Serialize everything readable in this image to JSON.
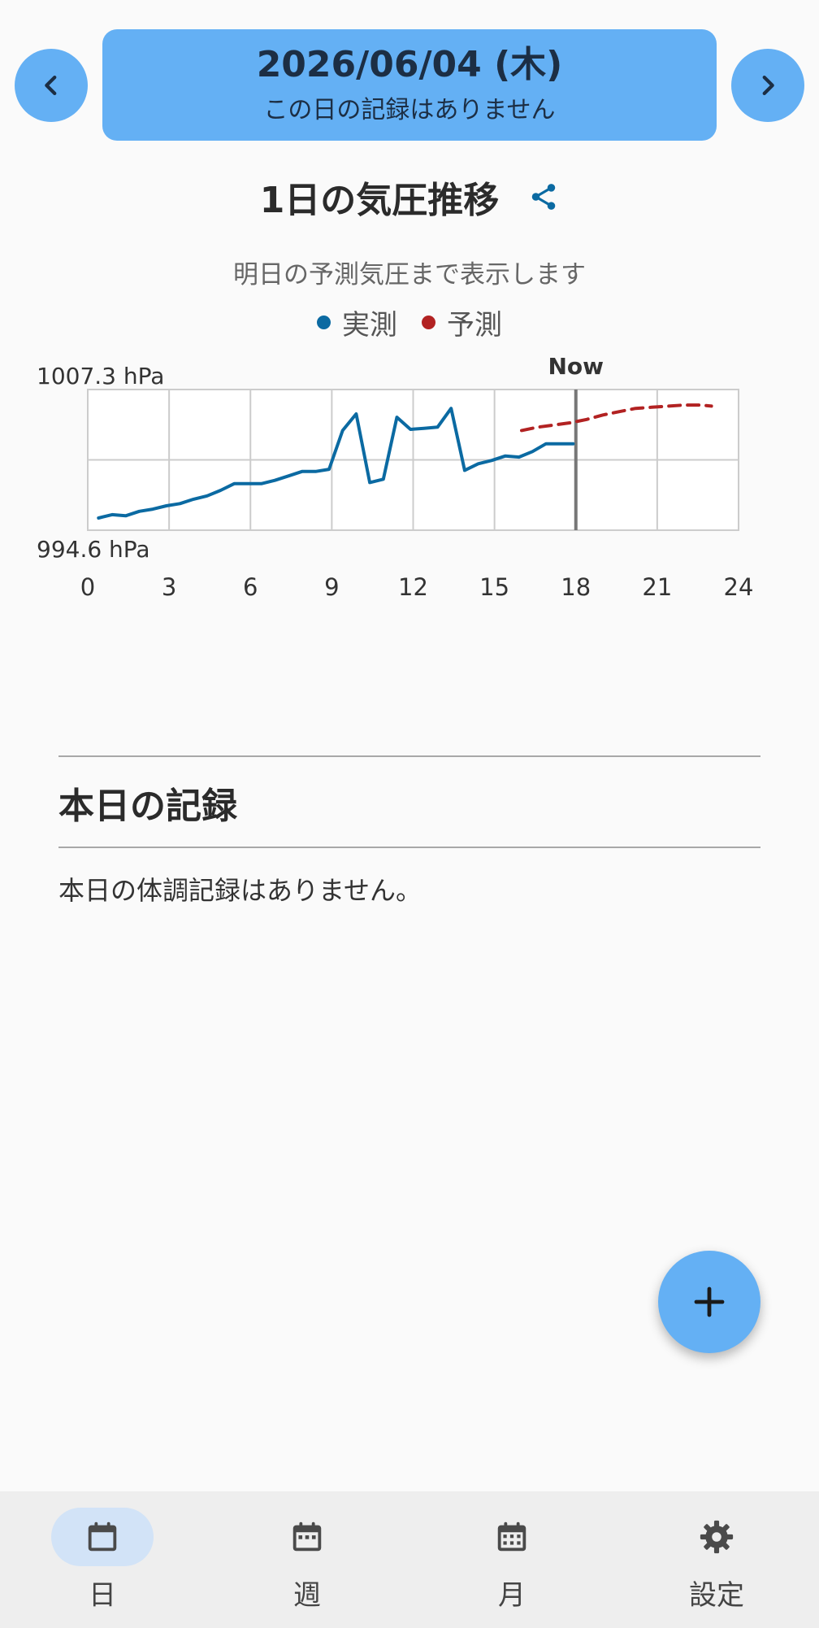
{
  "header": {
    "date": "2026/06/04 (木)",
    "subtitle": "この日の記録はありません",
    "prev_icon": "chevron-left-icon",
    "next_icon": "chevron-right-icon",
    "accent": "#64b0f4"
  },
  "chart_section": {
    "title": "1日の気圧推移",
    "share_icon": "share-icon",
    "subtitle": "明日の予測気圧まで表示します"
  },
  "chart_data": {
    "type": "line",
    "title": "",
    "xlabel": "",
    "ylabel": "",
    "xlim": [
      0,
      24
    ],
    "ylim": [
      994.6,
      1007.3
    ],
    "ylim_labels": [
      "1007.3 hPa",
      "994.6 hPa"
    ],
    "x_ticks": [
      "0",
      "3",
      "6",
      "9",
      "12",
      "15",
      "18",
      "21",
      "24"
    ],
    "now_label": "Now",
    "now_x": 18,
    "grid": true,
    "legend_position": "top",
    "series": [
      {
        "name": "実測",
        "color": "#0b6aa2",
        "style": "solid",
        "x": [
          0.4,
          0.9,
          1.4,
          1.9,
          2.4,
          2.9,
          3.4,
          3.9,
          4.4,
          4.9,
          5.4,
          5.9,
          6.4,
          6.9,
          7.4,
          7.9,
          8.4,
          8.9,
          9.4,
          9.9,
          10.4,
          10.9,
          11.4,
          11.9,
          12.4,
          12.9,
          13.4,
          13.9,
          14.4,
          14.9,
          15.4,
          15.9,
          16.4,
          16.9,
          17.4,
          17.9
        ],
        "y": [
          995.7,
          996.0,
          995.9,
          996.3,
          996.5,
          996.8,
          997.0,
          997.4,
          997.7,
          998.2,
          998.8,
          998.8,
          998.8,
          999.1,
          999.5,
          999.9,
          999.9,
          1000.1,
          1003.6,
          1005.1,
          998.9,
          999.2,
          1004.8,
          1003.7,
          1003.8,
          1003.9,
          1005.6,
          1000.0,
          1000.6,
          1000.9,
          1001.3,
          1001.2,
          1001.7,
          1002.4,
          1002.4,
          1002.4
        ]
      },
      {
        "name": "予測",
        "color": "#b22222",
        "style": "dashed",
        "x": [
          16.0,
          16.6,
          17.2,
          17.8,
          18.4,
          19.0,
          19.6,
          20.2,
          20.8,
          21.4,
          22.0,
          22.6,
          23.0
        ],
        "y": [
          1003.6,
          1003.9,
          1004.1,
          1004.3,
          1004.6,
          1005.0,
          1005.3,
          1005.6,
          1005.7,
          1005.8,
          1005.9,
          1005.9,
          1005.8
        ]
      }
    ]
  },
  "records": {
    "title": "本日の記録",
    "empty_message": "本日の体調記録はありません。"
  },
  "fab": {
    "icon": "plus-icon"
  },
  "bottom_nav": {
    "items": [
      {
        "label": "日",
        "icon": "calendar-day-icon",
        "active": true
      },
      {
        "label": "週",
        "icon": "calendar-week-icon",
        "active": false
      },
      {
        "label": "月",
        "icon": "calendar-month-icon",
        "active": false
      },
      {
        "label": "設定",
        "icon": "gear-icon",
        "active": false
      }
    ]
  }
}
